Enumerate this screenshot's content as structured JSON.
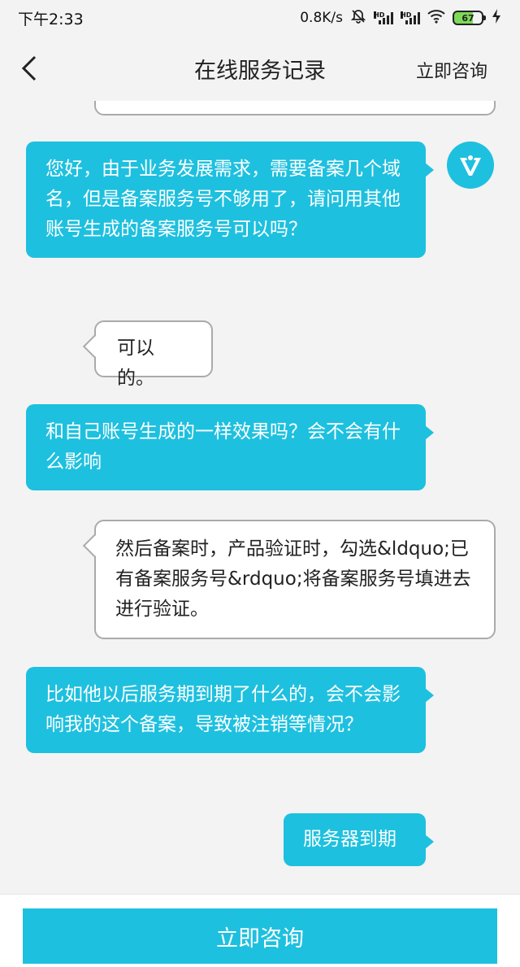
{
  "status_bar": {
    "time": "下午2:33",
    "net_speed": "0.8K/s",
    "hd_label": "HD",
    "battery": "67"
  },
  "nav": {
    "title": "在线服务记录",
    "action": "立即咨询"
  },
  "messages": [
    {
      "role": "user",
      "text": "您好，由于业务发展需求，需要备案几个域名，但是备案服务号不够用了，请问用其他账号生成的备案服务号可以吗？"
    },
    {
      "role": "agent",
      "text": "可以的。"
    },
    {
      "role": "user",
      "text": "和自己账号生成的一样效果吗？会不会有什么影响"
    },
    {
      "role": "agent",
      "text": "然后备案时，产品验证时，勾选&ldquo;已有备案服务号&rdquo;将备案服务号填进去进行验证。"
    },
    {
      "role": "user",
      "text": "比如他以后服务期到期了什么的，会不会影响我的这个备案，导致被注销等情况？"
    },
    {
      "role": "user",
      "text": "服务器到期"
    }
  ],
  "bottom": {
    "button_label": "立即咨询"
  },
  "colors": {
    "accent": "#1ec0df",
    "background": "#f3f3f3",
    "agent_bubble": "#ffffff",
    "agent_border": "#aaaaaa"
  },
  "icons": {
    "back": "chevron-left-icon",
    "avatar": "brand-logo-icon",
    "mute": "bell-off-icon",
    "wifi": "wifi-icon",
    "charging": "lightning-icon"
  }
}
